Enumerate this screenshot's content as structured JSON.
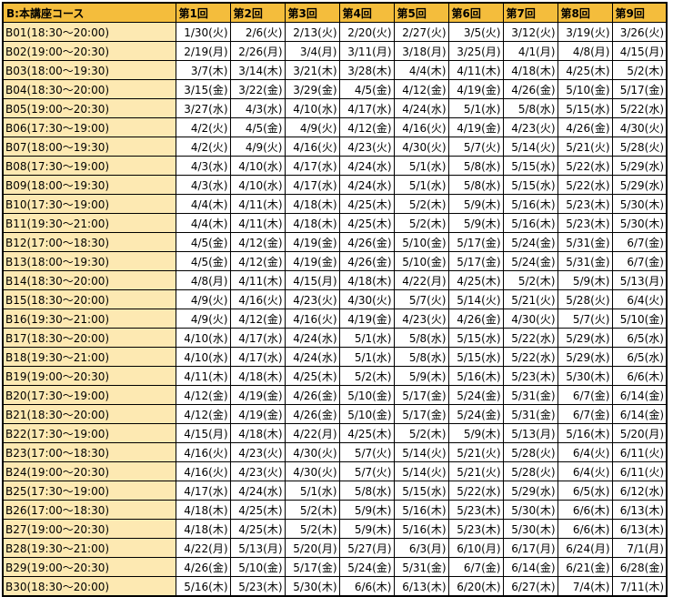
{
  "header": [
    "B:本講座コース",
    "第1回",
    "第2回",
    "第3回",
    "第4回",
    "第5回",
    "第6回",
    "第7回",
    "第8回",
    "第9回"
  ],
  "rows": [
    [
      "B01(18:30～20:00)",
      "1/30(火)",
      "2/6(火)",
      "2/13(火)",
      "2/20(火)",
      "2/27(火)",
      "3/5(火)",
      "3/12(火)",
      "3/19(火)",
      "3/26(火)"
    ],
    [
      "B02(19:00～20:30)",
      "2/19(月)",
      "2/26(月)",
      "3/4(月)",
      "3/11(月)",
      "3/18(月)",
      "3/25(月)",
      "4/1(月)",
      "4/8(月)",
      "4/15(月)"
    ],
    [
      "B03(18:00～19:30)",
      "3/7(木)",
      "3/14(木)",
      "3/21(木)",
      "3/28(木)",
      "4/4(木)",
      "4/11(木)",
      "4/18(木)",
      "4/25(木)",
      "5/2(木)"
    ],
    [
      "B04(18:30～20:00)",
      "3/15(金)",
      "3/22(金)",
      "3/29(金)",
      "4/5(金)",
      "4/12(金)",
      "4/19(金)",
      "4/26(金)",
      "5/10(金)",
      "5/17(金)"
    ],
    [
      "B05(19:00～20:30)",
      "3/27(水)",
      "4/3(水)",
      "4/10(水)",
      "4/17(水)",
      "4/24(水)",
      "5/1(水)",
      "5/8(水)",
      "5/15(水)",
      "5/22(水)"
    ],
    [
      "B06(17:30～19:00)",
      "4/2(火)",
      "4/5(金)",
      "4/9(火)",
      "4/12(金)",
      "4/16(火)",
      "4/19(金)",
      "4/23(火)",
      "4/26(金)",
      "4/30(火)"
    ],
    [
      "B07(18:00～19:30)",
      "4/2(火)",
      "4/9(火)",
      "4/16(火)",
      "4/23(火)",
      "4/30(火)",
      "5/7(火)",
      "5/14(火)",
      "5/21(火)",
      "5/28(火)"
    ],
    [
      "B08(17:30～19:00)",
      "4/3(水)",
      "4/10(水)",
      "4/17(水)",
      "4/24(水)",
      "5/1(水)",
      "5/8(水)",
      "5/15(水)",
      "5/22(水)",
      "5/29(水)"
    ],
    [
      "B09(18:00～19:30)",
      "4/3(水)",
      "4/10(水)",
      "4/17(水)",
      "4/24(水)",
      "5/1(水)",
      "5/8(水)",
      "5/15(水)",
      "5/22(水)",
      "5/29(水)"
    ],
    [
      "B10(17:30～19:00)",
      "4/4(木)",
      "4/11(木)",
      "4/18(木)",
      "4/25(木)",
      "5/2(木)",
      "5/9(木)",
      "5/16(木)",
      "5/23(木)",
      "5/30(木)"
    ],
    [
      "B11(19:30～21:00)",
      "4/4(木)",
      "4/11(木)",
      "4/18(木)",
      "4/25(木)",
      "5/2(木)",
      "5/9(木)",
      "5/16(木)",
      "5/23(木)",
      "5/30(木)"
    ],
    [
      "B12(17:00～18:30)",
      "4/5(金)",
      "4/12(金)",
      "4/19(金)",
      "4/26(金)",
      "5/10(金)",
      "5/17(金)",
      "5/24(金)",
      "5/31(金)",
      "6/7(金)"
    ],
    [
      "B13(18:00～19:30)",
      "4/5(金)",
      "4/12(金)",
      "4/19(金)",
      "4/26(金)",
      "5/10(金)",
      "5/17(金)",
      "5/24(金)",
      "5/31(金)",
      "6/7(金)"
    ],
    [
      "B14(18:30～20:00)",
      "4/8(月)",
      "4/11(木)",
      "4/15(月)",
      "4/18(木)",
      "4/22(月)",
      "4/25(木)",
      "5/2(木)",
      "5/9(木)",
      "5/13(月)"
    ],
    [
      "B15(18:30～20:00)",
      "4/9(火)",
      "4/16(火)",
      "4/23(火)",
      "4/30(火)",
      "5/7(火)",
      "5/14(火)",
      "5/21(火)",
      "5/28(火)",
      "6/4(火)"
    ],
    [
      "B16(19:30～21:00)",
      "4/9(火)",
      "4/12(金)",
      "4/16(火)",
      "4/19(金)",
      "4/23(火)",
      "4/26(金)",
      "4/30(火)",
      "5/7(火)",
      "5/10(金)"
    ],
    [
      "B17(18:30～20:00)",
      "4/10(水)",
      "4/17(水)",
      "4/24(水)",
      "5/1(水)",
      "5/8(水)",
      "5/15(水)",
      "5/22(水)",
      "5/29(水)",
      "6/5(水)"
    ],
    [
      "B18(19:30～21:00)",
      "4/10(水)",
      "4/17(水)",
      "4/24(水)",
      "5/1(水)",
      "5/8(水)",
      "5/15(水)",
      "5/22(水)",
      "5/29(水)",
      "6/5(水)"
    ],
    [
      "B19(19:00～20:30)",
      "4/11(木)",
      "4/18(木)",
      "4/25(木)",
      "5/2(木)",
      "5/9(木)",
      "5/16(木)",
      "5/23(木)",
      "5/30(木)",
      "6/6(木)"
    ],
    [
      "B20(17:30～19:00)",
      "4/12(金)",
      "4/19(金)",
      "4/26(金)",
      "5/10(金)",
      "5/17(金)",
      "5/24(金)",
      "5/31(金)",
      "6/7(金)",
      "6/14(金)"
    ],
    [
      "B21(18:30～20:00)",
      "4/12(金)",
      "4/19(金)",
      "4/26(金)",
      "5/10(金)",
      "5/17(金)",
      "5/24(金)",
      "5/31(金)",
      "6/7(金)",
      "6/14(金)"
    ],
    [
      "B22(17:30～19:00)",
      "4/15(月)",
      "4/18(木)",
      "4/22(月)",
      "4/25(木)",
      "5/2(木)",
      "5/9(木)",
      "5/13(月)",
      "5/16(木)",
      "5/20(月)"
    ],
    [
      "B23(17:00～18:30)",
      "4/16(火)",
      "4/23(火)",
      "4/30(火)",
      "5/7(火)",
      "5/14(火)",
      "5/21(火)",
      "5/28(火)",
      "6/4(火)",
      "6/11(火)"
    ],
    [
      "B24(19:00～20:30)",
      "4/16(火)",
      "4/23(火)",
      "4/30(火)",
      "5/7(火)",
      "5/14(火)",
      "5/21(火)",
      "5/28(火)",
      "6/4(火)",
      "6/11(火)"
    ],
    [
      "B25(17:30～19:00)",
      "4/17(水)",
      "4/24(水)",
      "5/1(水)",
      "5/8(水)",
      "5/15(水)",
      "5/22(水)",
      "5/29(水)",
      "6/5(水)",
      "6/12(水)"
    ],
    [
      "B26(17:00～18:30)",
      "4/18(木)",
      "4/25(木)",
      "5/2(木)",
      "5/9(木)",
      "5/16(木)",
      "5/23(木)",
      "5/30(木)",
      "6/6(木)",
      "6/13(木)"
    ],
    [
      "B27(19:00～20:30)",
      "4/18(木)",
      "4/25(木)",
      "5/2(木)",
      "5/9(木)",
      "5/16(木)",
      "5/23(木)",
      "5/30(木)",
      "6/6(木)",
      "6/13(木)"
    ],
    [
      "B28(19:30～21:00)",
      "4/22(月)",
      "5/13(月)",
      "5/20(月)",
      "5/27(月)",
      "6/3(月)",
      "6/10(月)",
      "6/17(月)",
      "6/24(月)",
      "7/1(月)"
    ],
    [
      "B29(19:00～20:30)",
      "4/26(金)",
      "5/10(金)",
      "5/17(金)",
      "5/24(金)",
      "5/31(金)",
      "6/7(金)",
      "6/14(金)",
      "6/21(金)",
      "6/28(金)"
    ],
    [
      "B30(18:30～20:00)",
      "5/16(木)",
      "5/23(木)",
      "5/30(木)",
      "6/6(木)",
      "6/13(木)",
      "6/20(木)",
      "6/27(木)",
      "7/4(木)",
      "7/11(木)"
    ]
  ]
}
